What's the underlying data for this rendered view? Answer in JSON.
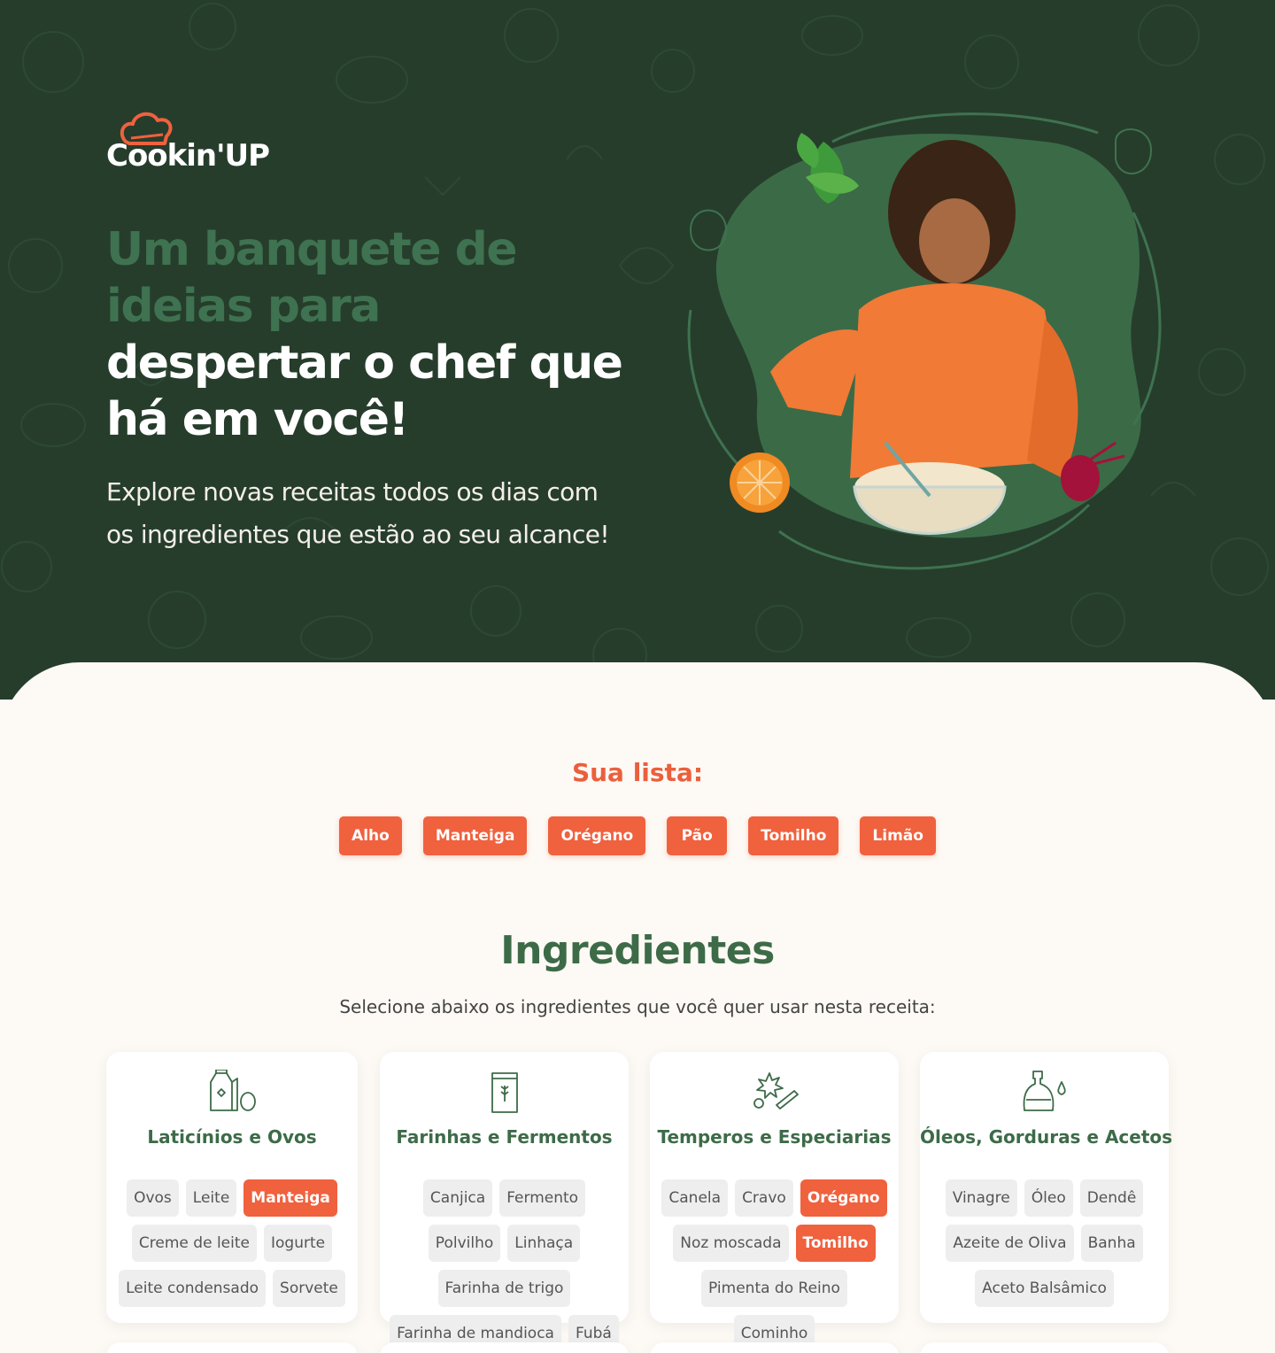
{
  "brand": {
    "logo_text": "Cookin'UP"
  },
  "hero": {
    "headline_green": [
      "Um banquete de",
      "ideias para"
    ],
    "headline_white": [
      "despertar o chef que",
      "há em você!"
    ],
    "subtitle": [
      "Explore novas receitas todos os dias com",
      "os ingredientes que estão ao seu alcance!"
    ]
  },
  "list": {
    "title": "Sua lista:",
    "items": [
      "Alho",
      "Manteiga",
      "Orégano",
      "Pão",
      "Tomilho",
      "Limão"
    ]
  },
  "ingredients": {
    "title": "Ingredientes",
    "subtitle": "Selecione abaixo os ingredientes que você quer usar nesta receita:",
    "categories": [
      {
        "name": "Laticínios e Ovos",
        "icon": "milk-and-egg-icon",
        "items": [
          {
            "label": "Ovos",
            "selected": false
          },
          {
            "label": "Leite",
            "selected": false
          },
          {
            "label": "Manteiga",
            "selected": true
          },
          {
            "label": "Creme de leite",
            "selected": false
          },
          {
            "label": "Iogurte",
            "selected": false
          },
          {
            "label": "Leite condensado",
            "selected": false
          },
          {
            "label": "Sorvete",
            "selected": false
          }
        ]
      },
      {
        "name": "Farinhas e Fermentos",
        "icon": "flour-bag-icon",
        "items": [
          {
            "label": "Canjica",
            "selected": false
          },
          {
            "label": "Fermento",
            "selected": false
          },
          {
            "label": "Polvilho",
            "selected": false
          },
          {
            "label": "Linhaça",
            "selected": false
          },
          {
            "label": "Farinha de trigo",
            "selected": false
          },
          {
            "label": "Farinha de mandioca",
            "selected": false
          },
          {
            "label": "Fubá",
            "selected": false
          }
        ]
      },
      {
        "name": "Temperos e Especiarias",
        "icon": "spices-icon",
        "items": [
          {
            "label": "Canela",
            "selected": false
          },
          {
            "label": "Cravo",
            "selected": false
          },
          {
            "label": "Orégano",
            "selected": true
          },
          {
            "label": "Noz moscada",
            "selected": false
          },
          {
            "label": "Tomilho",
            "selected": true
          },
          {
            "label": "Pimenta do Reino",
            "selected": false
          },
          {
            "label": "Cominho",
            "selected": false
          }
        ]
      },
      {
        "name": "Óleos, Gorduras e Acetos",
        "icon": "oil-bottle-icon",
        "items": [
          {
            "label": "Vinagre",
            "selected": false
          },
          {
            "label": "Óleo",
            "selected": false
          },
          {
            "label": "Dendê",
            "selected": false
          },
          {
            "label": "Azeite de Oliva",
            "selected": false
          },
          {
            "label": "Banha",
            "selected": false
          },
          {
            "label": "Aceto Balsâmico",
            "selected": false
          }
        ]
      }
    ]
  },
  "colors": {
    "hero_bg": "#263d2c",
    "accent": "#f0613e",
    "green_text": "#3d6b48",
    "cream_bg": "#fdf9f4"
  }
}
